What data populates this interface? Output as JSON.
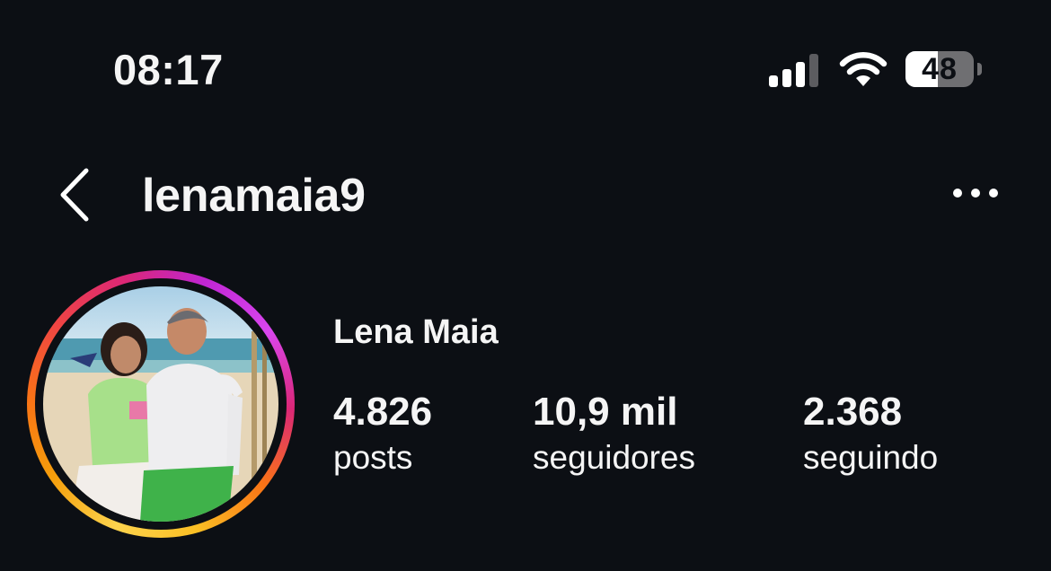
{
  "status_bar": {
    "time": "08:17",
    "signal_icon": "cellular-signal-icon",
    "wifi_icon": "wifi-icon",
    "battery_level": "48",
    "battery_fraction": 0.48
  },
  "header": {
    "back_icon": "chevron-left-icon",
    "username": "lenamaia9",
    "more_icon": "ellipsis-icon"
  },
  "profile": {
    "avatar_icon": "profile-photo",
    "display_name": "Lena Maia",
    "stats": [
      {
        "value": "4.826",
        "label": "posts"
      },
      {
        "value": "10,9 mil",
        "label": "seguidores"
      },
      {
        "value": "2.368",
        "label": "seguindo"
      }
    ]
  },
  "colors": {
    "background": "#0c0f14",
    "text": "#f5f5f5",
    "story_ring_start": "#fcd34d",
    "story_ring_end": "#d946ef"
  }
}
